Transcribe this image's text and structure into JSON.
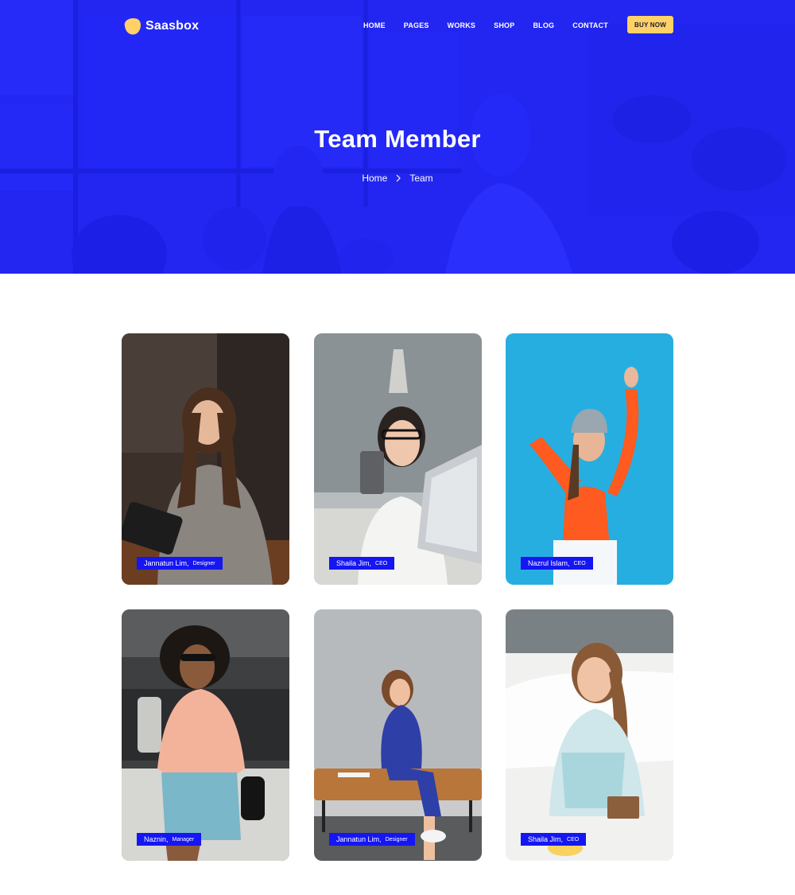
{
  "brand": {
    "name": "Saasbox",
    "logo_color": "#ffd166"
  },
  "nav": {
    "items": [
      "HOME",
      "PAGES",
      "WORKS",
      "SHOP",
      "BLOG",
      "CONTACT"
    ],
    "cta_label": "BUY NOW"
  },
  "hero": {
    "title": "Team Member",
    "breadcrumb": {
      "home": "Home",
      "current": "Team"
    },
    "overlay_color": "#1a1ef7"
  },
  "team": [
    {
      "name": "Jannatun Lim",
      "role": "Designer"
    },
    {
      "name": "Shaila Jim",
      "role": "CEO"
    },
    {
      "name": "Nazrul Islam",
      "role": "CEO"
    },
    {
      "name": "Naznin",
      "role": "Manager"
    },
    {
      "name": "Jannatun Lim",
      "role": "Designer"
    },
    {
      "name": "Shaila Jim",
      "role": "CEO"
    }
  ],
  "colors": {
    "accent_blue": "#1516f2",
    "cta_yellow": "#ffd166"
  }
}
